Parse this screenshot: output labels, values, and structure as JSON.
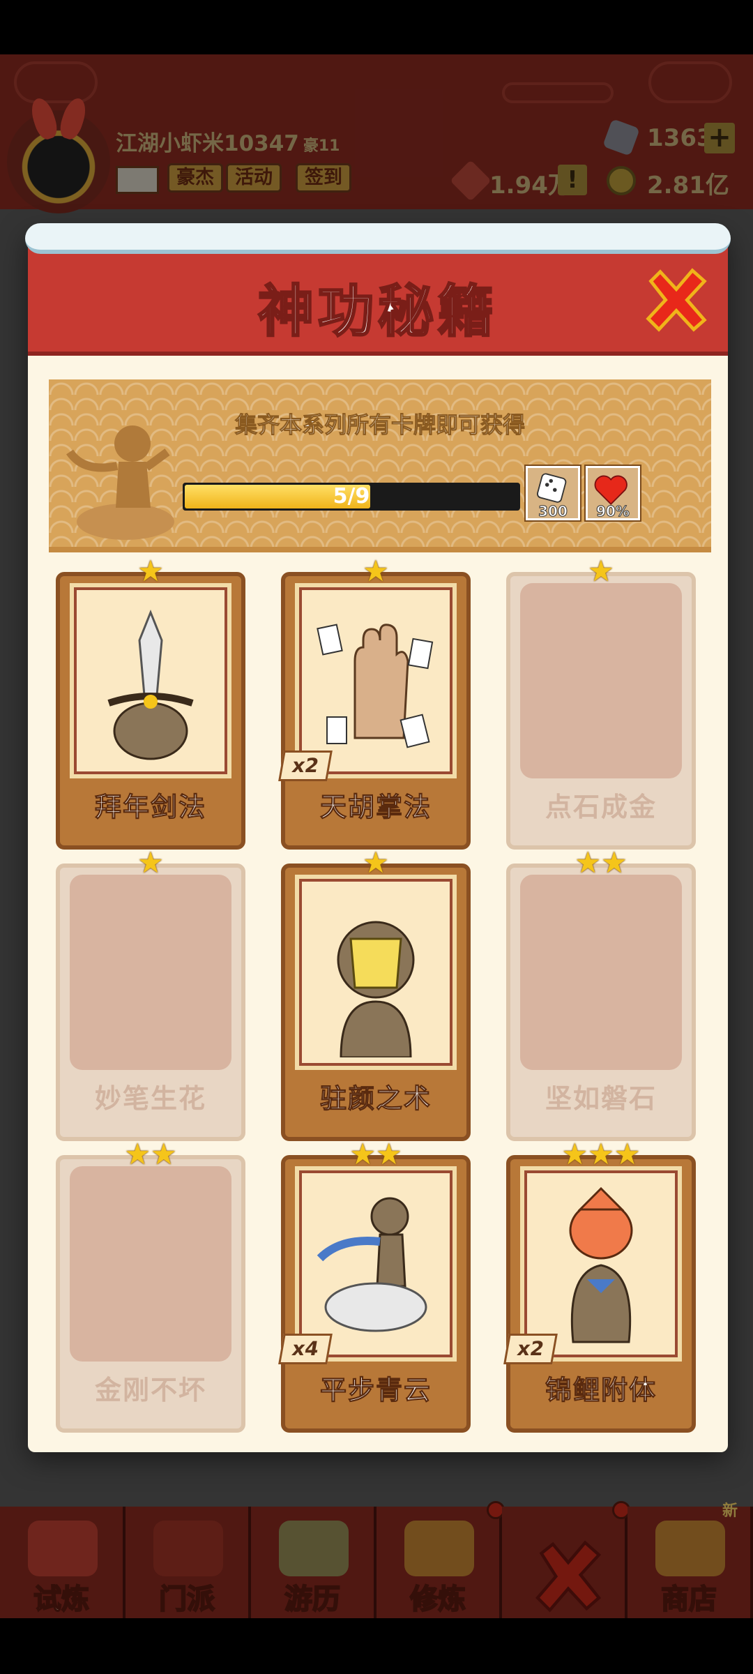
{
  "player": {
    "name": "江湖小虾米10347",
    "rank": "豪11",
    "tags": [
      "豪杰",
      "活动",
      "签到"
    ],
    "gems": "1363",
    "power": "1.94万",
    "coins": "2.81亿"
  },
  "modal": {
    "title": "神功秘籍",
    "banner_text": "集齐本系列所有卡牌即可获得",
    "progress_label": "5/9",
    "progress_fraction": 0.5556,
    "rewards": [
      {
        "icon": "dice-icon",
        "value": "300"
      },
      {
        "icon": "heart-icon",
        "value": "90%"
      }
    ]
  },
  "cards": [
    {
      "name": "拜年剑法",
      "stars": "★",
      "owned": true,
      "count": ""
    },
    {
      "name": "天胡掌法",
      "stars": "★",
      "owned": true,
      "count": "x2"
    },
    {
      "name": "点石成金",
      "stars": "★",
      "owned": false,
      "count": ""
    },
    {
      "name": "妙笔生花",
      "stars": "★",
      "owned": false,
      "count": ""
    },
    {
      "name": "驻颜之术",
      "stars": "★",
      "owned": true,
      "count": ""
    },
    {
      "name": "坚如磐石",
      "stars": "★★",
      "owned": false,
      "count": ""
    },
    {
      "name": "金刚不坏",
      "stars": "★★",
      "owned": false,
      "count": ""
    },
    {
      "name": "平步青云",
      "stars": "★★",
      "owned": true,
      "count": "x4"
    },
    {
      "name": "锦鲤附体",
      "stars": "★★★",
      "owned": true,
      "count": "x2"
    }
  ],
  "nav": [
    {
      "label": "试炼",
      "dot": false
    },
    {
      "label": "门派",
      "dot": false
    },
    {
      "label": "游历",
      "dot": false
    },
    {
      "label": "修炼",
      "dot": true
    },
    {
      "label": "",
      "dot": true
    },
    {
      "label": "商店",
      "dot": false
    }
  ],
  "new_badge": "新",
  "colors": {
    "accent": "#c63a32",
    "card_owned": "#b87838",
    "card_locked": "#e8d6c4",
    "star": "#f5c51a"
  }
}
